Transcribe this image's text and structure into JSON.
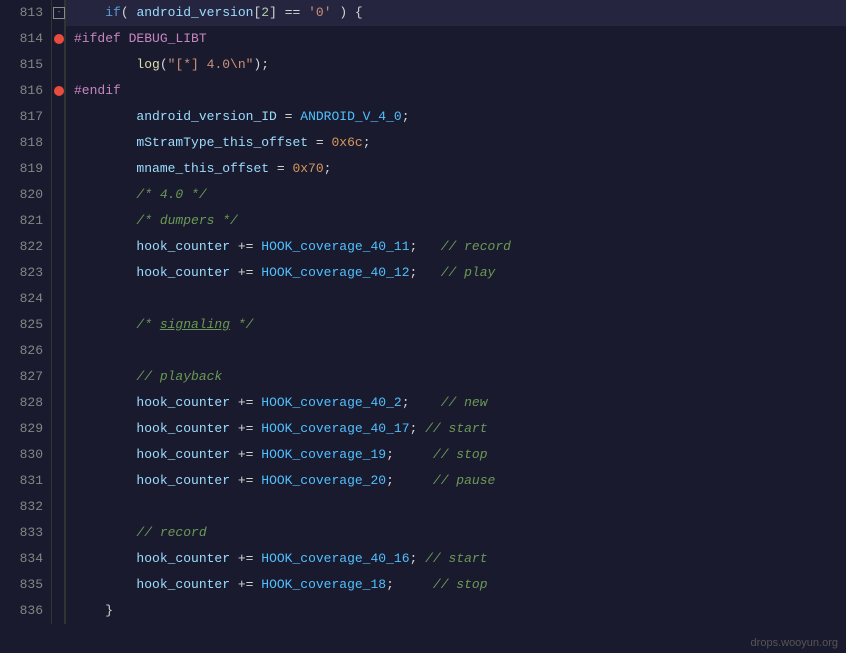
{
  "editor": {
    "background": "#1a1a2e",
    "watermark": "drops.wooyun.org"
  },
  "lines": [
    {
      "num": "813",
      "hasBreakpoint": false,
      "hasCollapse": true,
      "content": "813_if"
    },
    {
      "num": "814",
      "hasBreakpoint": true,
      "hasCollapse": false,
      "content": "814_ifdef"
    },
    {
      "num": "815",
      "hasBreakpoint": false,
      "hasCollapse": false,
      "content": "815_log"
    },
    {
      "num": "816",
      "hasBreakpoint": true,
      "hasCollapse": false,
      "content": "816_endif"
    },
    {
      "num": "817",
      "hasBreakpoint": false,
      "hasCollapse": false,
      "content": "817_android_ver"
    },
    {
      "num": "818",
      "hasBreakpoint": false,
      "hasCollapse": false,
      "content": "818_mstram"
    },
    {
      "num": "819",
      "hasBreakpoint": false,
      "hasCollapse": false,
      "content": "819_mname"
    },
    {
      "num": "820",
      "hasBreakpoint": false,
      "hasCollapse": false,
      "content": "820_comment40"
    },
    {
      "num": "821",
      "hasBreakpoint": false,
      "hasCollapse": false,
      "content": "821_dumpers"
    },
    {
      "num": "822",
      "hasBreakpoint": false,
      "hasCollapse": false,
      "content": "822_hook_record"
    },
    {
      "num": "823",
      "hasBreakpoint": false,
      "hasCollapse": false,
      "content": "823_hook_play"
    },
    {
      "num": "824",
      "hasBreakpoint": false,
      "hasCollapse": false,
      "content": "824_empty"
    },
    {
      "num": "825",
      "hasBreakpoint": false,
      "hasCollapse": false,
      "content": "825_signaling"
    },
    {
      "num": "826",
      "hasBreakpoint": false,
      "hasCollapse": false,
      "content": "826_empty"
    },
    {
      "num": "827",
      "hasBreakpoint": false,
      "hasCollapse": false,
      "content": "827_playback"
    },
    {
      "num": "828",
      "hasBreakpoint": false,
      "hasCollapse": false,
      "content": "828_hook_new"
    },
    {
      "num": "829",
      "hasBreakpoint": false,
      "hasCollapse": false,
      "content": "829_hook_start"
    },
    {
      "num": "830",
      "hasBreakpoint": false,
      "hasCollapse": false,
      "content": "830_hook_stop"
    },
    {
      "num": "831",
      "hasBreakpoint": false,
      "hasCollapse": false,
      "content": "831_hook_pause"
    },
    {
      "num": "832",
      "hasBreakpoint": false,
      "hasCollapse": false,
      "content": "832_empty"
    },
    {
      "num": "833",
      "hasBreakpoint": false,
      "hasCollapse": false,
      "content": "833_record"
    },
    {
      "num": "834",
      "hasBreakpoint": false,
      "hasCollapse": false,
      "content": "834_hook_rec_start"
    },
    {
      "num": "835",
      "hasBreakpoint": false,
      "hasCollapse": false,
      "content": "835_hook_rec_stop"
    },
    {
      "num": "836",
      "hasBreakpoint": false,
      "hasCollapse": false,
      "content": "836_close"
    }
  ]
}
